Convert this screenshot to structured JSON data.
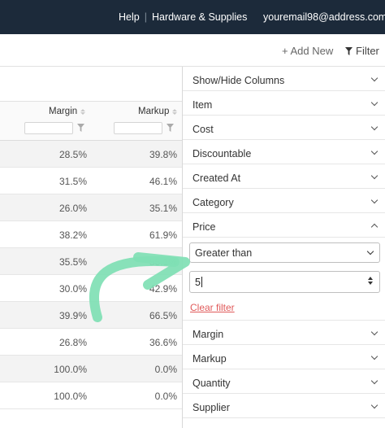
{
  "header": {
    "help": "Help",
    "hardware": "Hardware & Supplies",
    "email": "youremail98@address.com"
  },
  "toolbar": {
    "add_new": "+ Add New",
    "filter": "Filter"
  },
  "table": {
    "columns": [
      "Margin",
      "Markup"
    ],
    "rows": [
      [
        "28.5%",
        "39.8%"
      ],
      [
        "31.5%",
        "46.1%"
      ],
      [
        "26.0%",
        "35.1%"
      ],
      [
        "38.2%",
        "61.9%"
      ],
      [
        "35.5%",
        "55.1%"
      ],
      [
        "30.0%",
        "42.9%"
      ],
      [
        "39.9%",
        "66.5%"
      ],
      [
        "26.8%",
        "36.6%"
      ],
      [
        "100.0%",
        "0.0%"
      ],
      [
        "100.0%",
        "0.0%"
      ]
    ]
  },
  "panel": {
    "items_top": [
      "Show/Hide Columns",
      "Item",
      "Cost",
      "Discountable",
      "Created At",
      "Category"
    ],
    "price_label": "Price",
    "operator": "Greater than",
    "value": "5",
    "clear": "Clear filter",
    "items_bottom": [
      "Margin",
      "Markup",
      "Quantity",
      "Supplier"
    ]
  },
  "colors": {
    "header_bg": "#1c2a3a",
    "arrow": "#7fe0b4",
    "clear_link": "#e05a5a"
  }
}
